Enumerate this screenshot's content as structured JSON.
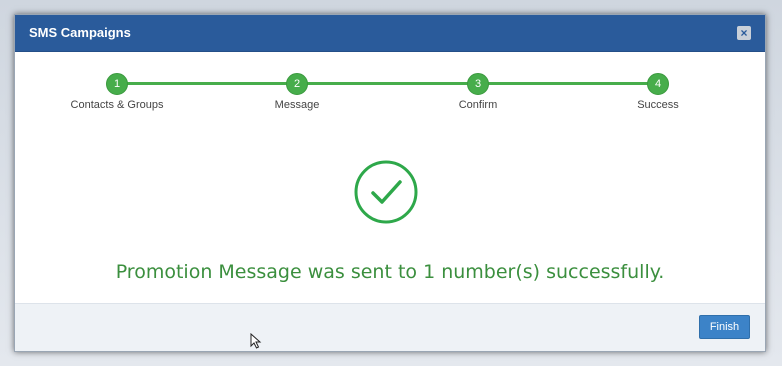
{
  "modal": {
    "title": "SMS Campaigns",
    "close_glyph": "×"
  },
  "steps": [
    {
      "number": "1",
      "label": "Contacts & Groups",
      "state": "complete"
    },
    {
      "number": "2",
      "label": "Message",
      "state": "complete"
    },
    {
      "number": "3",
      "label": "Confirm",
      "state": "complete"
    },
    {
      "number": "4",
      "label": "Success",
      "state": "complete"
    }
  ],
  "result": {
    "icon": "check-circle-icon",
    "message": "Promotion Message was sent to 1 number(s) successfully."
  },
  "footer": {
    "finish_label": "Finish"
  },
  "colors": {
    "header": "#2a5b9b",
    "step_complete": "#47ad4b",
    "success_text": "#3b8f3e",
    "primary_button": "#3c83c8"
  }
}
